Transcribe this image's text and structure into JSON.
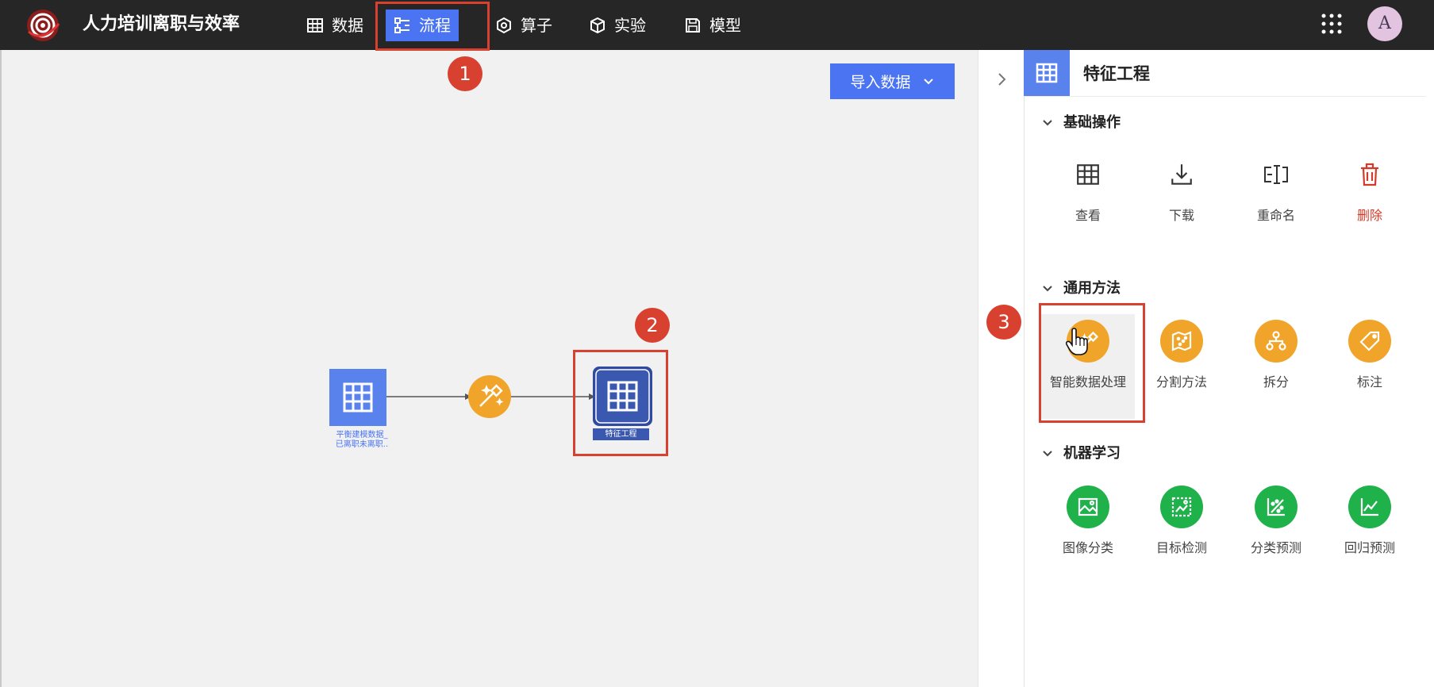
{
  "app": {
    "title": "人力培训离职与效率"
  },
  "nav": [
    {
      "label": "数据",
      "icon": "table-icon"
    },
    {
      "label": "流程",
      "icon": "flow-icon",
      "active": true
    },
    {
      "label": "算子",
      "icon": "hexagon-icon"
    },
    {
      "label": "实验",
      "icon": "cube-icon"
    },
    {
      "label": "模型",
      "icon": "save-icon"
    }
  ],
  "user": {
    "avatar_letter": "A"
  },
  "canvas": {
    "import_button": "导入数据",
    "nodes": {
      "source_label_line1": "平衡建模数据_",
      "source_label_line2": "已离职未离职..",
      "target_label": "特征工程"
    }
  },
  "annotations": [
    "1",
    "2",
    "3"
  ],
  "panel": {
    "title": "特征工程",
    "sections": [
      {
        "title": "基础操作",
        "items": [
          {
            "label": "查看",
            "icon": "table-icon"
          },
          {
            "label": "下载",
            "icon": "download-icon"
          },
          {
            "label": "重命名",
            "icon": "rename-icon"
          },
          {
            "label": "删除",
            "icon": "trash-icon",
            "danger": true
          }
        ]
      },
      {
        "title": "通用方法",
        "items": [
          {
            "label": "智能数据处理",
            "icon": "magic-wand-icon"
          },
          {
            "label": "分割方法",
            "icon": "map-icon"
          },
          {
            "label": "拆分",
            "icon": "hierarchy-icon"
          },
          {
            "label": "标注",
            "icon": "tag-icon"
          }
        ]
      },
      {
        "title": "机器学习",
        "items": [
          {
            "label": "图像分类",
            "icon": "image-icon"
          },
          {
            "label": "目标检测",
            "icon": "detection-icon"
          },
          {
            "label": "分类预测",
            "icon": "classification-icon"
          },
          {
            "label": "回归预测",
            "icon": "line-chart-icon"
          }
        ]
      }
    ]
  },
  "colors": {
    "accent": "#4a74f2",
    "annotation": "#d8412f",
    "orange": "#f1a42a",
    "green": "#1fb24a",
    "danger": "#d23a2a"
  }
}
